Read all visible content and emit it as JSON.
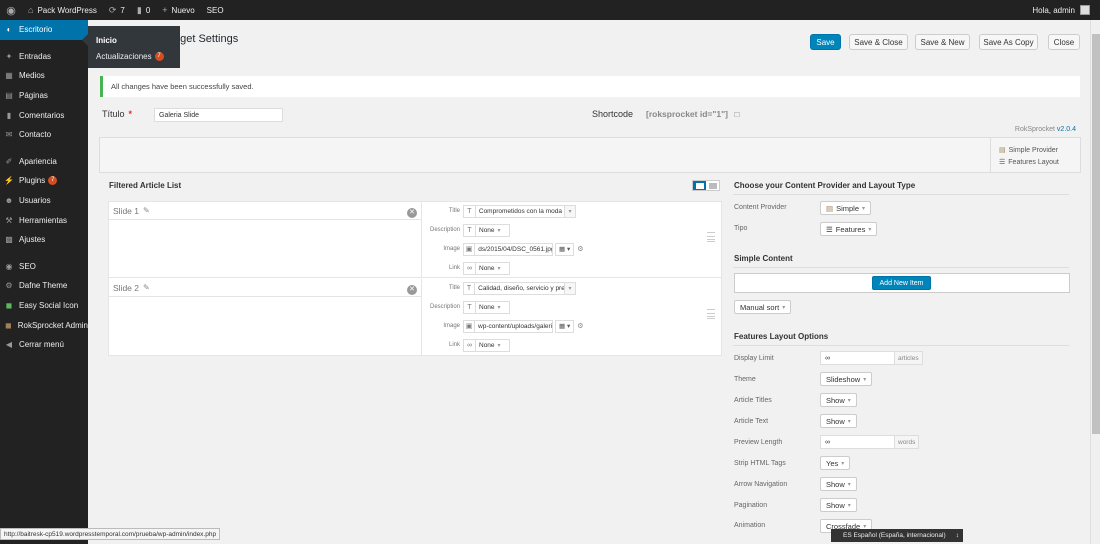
{
  "adminbar": {
    "site_name": "Pack WordPress",
    "updates_count": "7",
    "comments_count": "0",
    "new_label": "Nuevo",
    "seo_label": "SEO",
    "greeting": "Hola, admin"
  },
  "sidebar": {
    "items": [
      {
        "label": "Escritorio",
        "icon": "dashboard-icon"
      },
      {
        "label": "Entradas",
        "icon": "pushpin-icon"
      },
      {
        "label": "Medios",
        "icon": "media-icon"
      },
      {
        "label": "Páginas",
        "icon": "pages-icon"
      },
      {
        "label": "Comentarios",
        "icon": "comment-icon"
      },
      {
        "label": "Contacto",
        "icon": "mail-icon"
      },
      {
        "label": "Apariencia",
        "icon": "brush-icon"
      },
      {
        "label": "Plugins",
        "icon": "plug-icon",
        "badge": "7"
      },
      {
        "label": "Usuarios",
        "icon": "user-icon"
      },
      {
        "label": "Herramientas",
        "icon": "wrench-icon"
      },
      {
        "label": "Ajustes",
        "icon": "settings-icon"
      },
      {
        "label": "SEO",
        "icon": "seo-icon"
      },
      {
        "label": "Dafne Theme",
        "icon": "gear-icon"
      },
      {
        "label": "Easy Social Icon",
        "icon": "share-icon"
      },
      {
        "label": "RokSprocket Admin",
        "icon": "rocket-icon"
      },
      {
        "label": "Cerrar menú",
        "icon": "collapse-icon"
      }
    ],
    "flyout": {
      "first": "Inicio",
      "second": "Actualizaciones",
      "badge": "7"
    }
  },
  "header": {
    "title": "dget Settings",
    "buttons": {
      "save": "Save",
      "save_close": "Save & Close",
      "save_new": "Save & New",
      "save_copy": "Save As Copy",
      "close": "Close"
    }
  },
  "notice": "All changes have been successfully saved.",
  "form": {
    "title_label": "Título",
    "title_required": "*",
    "title_value": "Galeria Slide",
    "shortcode_label": "Shortcode",
    "shortcode_value": "[roksprocket id=\"1\"]",
    "version_prefix": "RokSprocket",
    "version": "v2.0.4"
  },
  "provider_box": {
    "provider": "Simple Provider",
    "layout": "Features Layout"
  },
  "articles": {
    "heading": "Filtered Article List",
    "field_labels": {
      "title": "Title",
      "description": "Description",
      "image": "Image",
      "link": "Link"
    },
    "slides": [
      {
        "name": "Slide 1",
        "title": "Comprometidos con la moda",
        "description": "None",
        "image": "ds/2015/04/DSC_0561.jpg",
        "link": "None"
      },
      {
        "name": "Slide 2",
        "title": "Calidad, diseño, servicio y prec",
        "description": "None",
        "image": "wp-content/uploads/galeria",
        "link": "None"
      }
    ]
  },
  "right": {
    "provider_heading": "Choose your Content Provider and Layout Type",
    "content_provider_label": "Content Provider",
    "content_provider_value": "Simple",
    "tipo_label": "Tipo",
    "tipo_value": "Features",
    "simple_heading": "Simple Content",
    "add_item_label": "Add New Item",
    "manual_sort_label": "Manual sort",
    "features_heading": "Features Layout Options",
    "options": {
      "display_limit_label": "Display Limit",
      "display_limit_value": "∞",
      "display_limit_suffix": "articles",
      "theme_label": "Theme",
      "theme_value": "Slideshow",
      "article_titles_label": "Article Titles",
      "article_titles_value": "Show",
      "article_text_label": "Article Text",
      "article_text_value": "Show",
      "preview_length_label": "Preview Length",
      "preview_length_value": "∞",
      "preview_length_suffix": "words",
      "strip_html_label": "Strip HTML Tags",
      "strip_html_value": "Yes",
      "arrow_nav_label": "Arrow Navigation",
      "arrow_nav_value": "Show",
      "pagination_label": "Pagination",
      "pagination_value": "Show",
      "animation_label": "Animation",
      "animation_value": "Crossfade"
    }
  },
  "statusbar": "http://baitresk-cp519.wordpresstemporal.com/prueba/wp-admin/index.php",
  "langbar": "ES Español (España, internacional)"
}
